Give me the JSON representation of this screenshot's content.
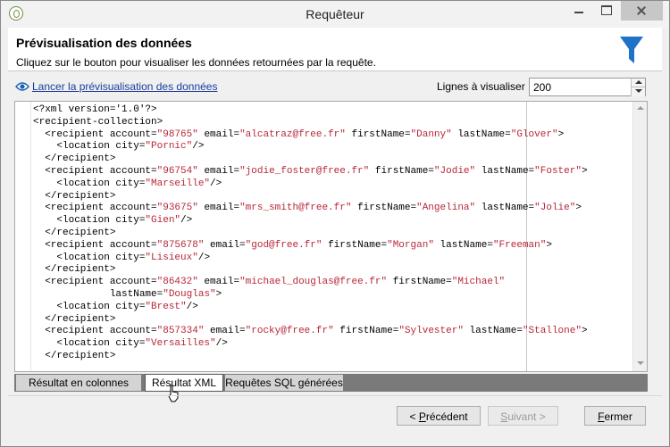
{
  "window": {
    "title": "Requêteur",
    "app_icon": "app-logo-icon"
  },
  "header": {
    "title": "Prévisualisation des données",
    "subtitle": "Cliquez sur le bouton pour visualiser les données retournées par la requête.",
    "icon": "funnel-icon",
    "icon_color": "#1e73c8"
  },
  "toolbar": {
    "preview_link": "Lancer la prévisualisation des données",
    "preview_icon": "eye-icon",
    "lines_label": "Lignes à visualiser :",
    "lines_value": "200"
  },
  "editor": {
    "lines": [
      [
        {
          "t": "tag",
          "s": "<?xml version='1.0'?>"
        }
      ],
      [
        {
          "t": "tag",
          "s": "<recipient-collection>"
        }
      ],
      [
        {
          "t": "tag",
          "s": "  <recipient account="
        },
        {
          "t": "val",
          "s": "\"98765\""
        },
        {
          "t": "tag",
          "s": " email="
        },
        {
          "t": "val",
          "s": "\"alcatraz@free.fr\""
        },
        {
          "t": "tag",
          "s": " firstName="
        },
        {
          "t": "val",
          "s": "\"Danny\""
        },
        {
          "t": "tag",
          "s": " lastName="
        },
        {
          "t": "val",
          "s": "\"Glover\""
        },
        {
          "t": "tag",
          "s": ">"
        }
      ],
      [
        {
          "t": "tag",
          "s": "    <location city="
        },
        {
          "t": "val",
          "s": "\"Pornic\""
        },
        {
          "t": "tag",
          "s": "/>"
        }
      ],
      [
        {
          "t": "tag",
          "s": "  </recipient>"
        }
      ],
      [
        {
          "t": "tag",
          "s": "  <recipient account="
        },
        {
          "t": "val",
          "s": "\"96754\""
        },
        {
          "t": "tag",
          "s": " email="
        },
        {
          "t": "val",
          "s": "\"jodie_foster@free.fr\""
        },
        {
          "t": "tag",
          "s": " firstName="
        },
        {
          "t": "val",
          "s": "\"Jodie\""
        },
        {
          "t": "tag",
          "s": " lastName="
        },
        {
          "t": "val",
          "s": "\"Foster\""
        },
        {
          "t": "tag",
          "s": ">"
        }
      ],
      [
        {
          "t": "tag",
          "s": "    <location city="
        },
        {
          "t": "val",
          "s": "\"Marseille\""
        },
        {
          "t": "tag",
          "s": "/>"
        }
      ],
      [
        {
          "t": "tag",
          "s": "  </recipient>"
        }
      ],
      [
        {
          "t": "tag",
          "s": "  <recipient account="
        },
        {
          "t": "val",
          "s": "\"93675\""
        },
        {
          "t": "tag",
          "s": " email="
        },
        {
          "t": "val",
          "s": "\"mrs_smith@free.fr\""
        },
        {
          "t": "tag",
          "s": " firstName="
        },
        {
          "t": "val",
          "s": "\"Angelina\""
        },
        {
          "t": "tag",
          "s": " lastName="
        },
        {
          "t": "val",
          "s": "\"Jolie\""
        },
        {
          "t": "tag",
          "s": ">"
        }
      ],
      [
        {
          "t": "tag",
          "s": "    <location city="
        },
        {
          "t": "val",
          "s": "\"Gien\""
        },
        {
          "t": "tag",
          "s": "/>"
        }
      ],
      [
        {
          "t": "tag",
          "s": "  </recipient>"
        }
      ],
      [
        {
          "t": "tag",
          "s": "  <recipient account="
        },
        {
          "t": "val",
          "s": "\"875678\""
        },
        {
          "t": "tag",
          "s": " email="
        },
        {
          "t": "val",
          "s": "\"god@free.fr\""
        },
        {
          "t": "tag",
          "s": " firstName="
        },
        {
          "t": "val",
          "s": "\"Morgan\""
        },
        {
          "t": "tag",
          "s": " lastName="
        },
        {
          "t": "val",
          "s": "\"Freeman\""
        },
        {
          "t": "tag",
          "s": ">"
        }
      ],
      [
        {
          "t": "tag",
          "s": "    <location city="
        },
        {
          "t": "val",
          "s": "\"Lisieux\""
        },
        {
          "t": "tag",
          "s": "/>"
        }
      ],
      [
        {
          "t": "tag",
          "s": "  </recipient>"
        }
      ],
      [
        {
          "t": "tag",
          "s": "  <recipient account="
        },
        {
          "t": "val",
          "s": "\"86432\""
        },
        {
          "t": "tag",
          "s": " email="
        },
        {
          "t": "val",
          "s": "\"michael_douglas@free.fr\""
        },
        {
          "t": "tag",
          "s": " firstName="
        },
        {
          "t": "val",
          "s": "\"Michael\""
        }
      ],
      [
        {
          "t": "tag",
          "s": "             lastName="
        },
        {
          "t": "val",
          "s": "\"Douglas\""
        },
        {
          "t": "tag",
          "s": ">"
        }
      ],
      [
        {
          "t": "tag",
          "s": "    <location city="
        },
        {
          "t": "val",
          "s": "\"Brest\""
        },
        {
          "t": "tag",
          "s": "/>"
        }
      ],
      [
        {
          "t": "tag",
          "s": "  </recipient>"
        }
      ],
      [
        {
          "t": "tag",
          "s": "  <recipient account="
        },
        {
          "t": "val",
          "s": "\"857334\""
        },
        {
          "t": "tag",
          "s": " email="
        },
        {
          "t": "val",
          "s": "\"rocky@free.fr\""
        },
        {
          "t": "tag",
          "s": " firstName="
        },
        {
          "t": "val",
          "s": "\"Sylvester\""
        },
        {
          "t": "tag",
          "s": " lastName="
        },
        {
          "t": "val",
          "s": "\"Stallone\""
        },
        {
          "t": "tag",
          "s": ">"
        }
      ],
      [
        {
          "t": "tag",
          "s": "    <location city="
        },
        {
          "t": "val",
          "s": "\"Versailles\""
        },
        {
          "t": "tag",
          "s": "/>"
        }
      ],
      [
        {
          "t": "tag",
          "s": "  </recipient>"
        }
      ]
    ],
    "value_color": "#b8283a"
  },
  "tabs": {
    "columns": "Résultat en colonnes",
    "xml": "Résultat XML",
    "sql": "Requêtes SQL générées",
    "active": "xml"
  },
  "buttons": {
    "previous_prefix": "< ",
    "previous_key": "P",
    "previous_rest": "récédent",
    "next_key": "S",
    "next_rest": "uivant >",
    "close_key": "F",
    "close_rest": "ermer"
  }
}
